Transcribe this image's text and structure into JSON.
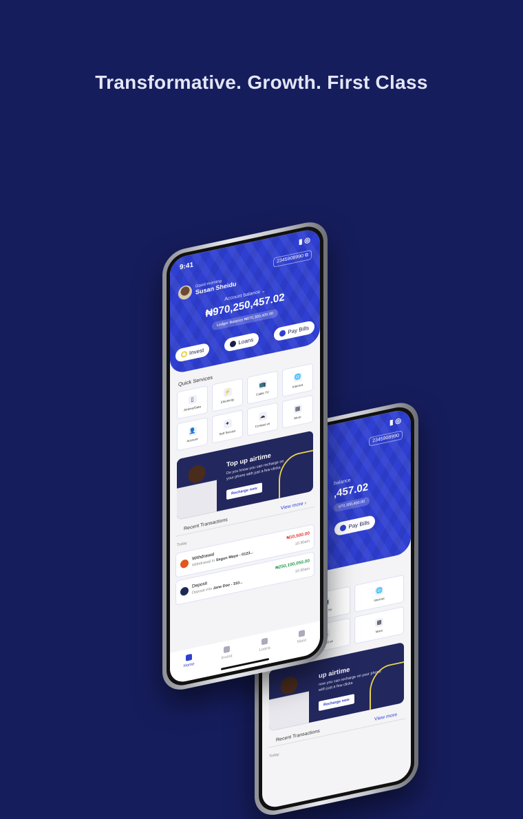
{
  "headline": "Transformative. Growth. First Class",
  "colors": {
    "background": "#161d5c",
    "brand": "#2f3fd1",
    "debit": "#e53935",
    "credit": "#2e9e4f"
  },
  "front": {
    "time": "9:41",
    "account_number": "2345908990",
    "greeting": "Good morning",
    "user_name": "Susan Sheidu",
    "balance_label": "Account balance",
    "balance": "₦970,250,457.02",
    "ledger": "Ledger Balance ₦970,300,400.00",
    "actions": [
      {
        "label": "Invest",
        "icon": "invest-icon"
      },
      {
        "label": "Loans",
        "icon": "loans-icon"
      },
      {
        "label": "Pay Bills",
        "icon": "bills-icon"
      }
    ],
    "quick_services_title": "Quick Services",
    "services": [
      {
        "label": "Airtime/Data",
        "icon": "phone-icon"
      },
      {
        "label": "Electricity",
        "icon": "bolt-icon"
      },
      {
        "label": "Cable TV",
        "icon": "tv-icon"
      },
      {
        "label": "Internet",
        "icon": "globe-icon"
      },
      {
        "label": "Account",
        "icon": "user-icon"
      },
      {
        "label": "Self Service",
        "icon": "self-service-icon"
      },
      {
        "label": "Contact us",
        "icon": "contact-icon"
      },
      {
        "label": "More",
        "icon": "grid-icon"
      }
    ],
    "banner": {
      "title": "Top up airtime",
      "desc": "Do you know you can recharge on your phone with just a few clicks",
      "button": "Recharge now"
    },
    "recent_title": "Recent Transactions",
    "view_more": "View more",
    "today": "Today",
    "transactions": [
      {
        "title": "Withdrawal",
        "prefix": "Withdrawal to",
        "party": "Segun Mayo - 0123...",
        "amount": "₦10,500.00",
        "time": "10:30am",
        "type": "debit"
      },
      {
        "title": "Deposit",
        "prefix": "Deposit into",
        "party": "Jane Doe - 310...",
        "amount": "₦250,100,050.00",
        "time": "10:30am",
        "type": "credit"
      }
    ],
    "nav": [
      "Home",
      "Invest",
      "Loans",
      "More"
    ]
  },
  "back": {
    "account_number": "2345908990",
    "balance_label": "balance",
    "balance": ",457.02",
    "ledger": "970,300,400.00",
    "actions": [
      "oans",
      "Pay Bills"
    ],
    "services": [
      "Cable TV",
      "Internet",
      "Contact us",
      "More"
    ],
    "banner_title": "up airtime",
    "banner_desc": "now you can recharge on your phone with just a few clicks",
    "button": "Recharge now",
    "view_more": "View more",
    "recent_title": "Recent Transactions",
    "today": "Today"
  }
}
